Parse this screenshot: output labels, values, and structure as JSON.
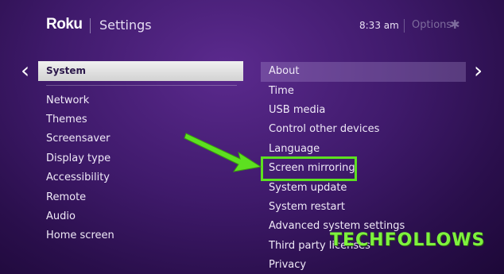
{
  "header": {
    "brand": "Roku",
    "title": "Settings",
    "time": "8:33  am",
    "options_label": "Options",
    "options_icon": "asterisk-icon"
  },
  "left_menu": {
    "selected": "System",
    "items": [
      "Network",
      "Themes",
      "Screensaver",
      "Display type",
      "Accessibility",
      "Remote",
      "Audio",
      "Home screen"
    ]
  },
  "right_menu": {
    "items": [
      "About",
      "Time",
      "USB media",
      "Control other devices",
      "Language",
      "Screen mirroring",
      "System update",
      "System restart",
      "Advanced system settings",
      "Third party licenses",
      "Privacy"
    ],
    "highlighted": "Screen mirroring"
  },
  "annotation": {
    "color": "#5de020"
  },
  "watermark": "TECHFOLLOWS",
  "colors": {
    "background": "#3f1a6b",
    "selected_bg": "#e8e8e8",
    "accent_green": "#5de020"
  }
}
